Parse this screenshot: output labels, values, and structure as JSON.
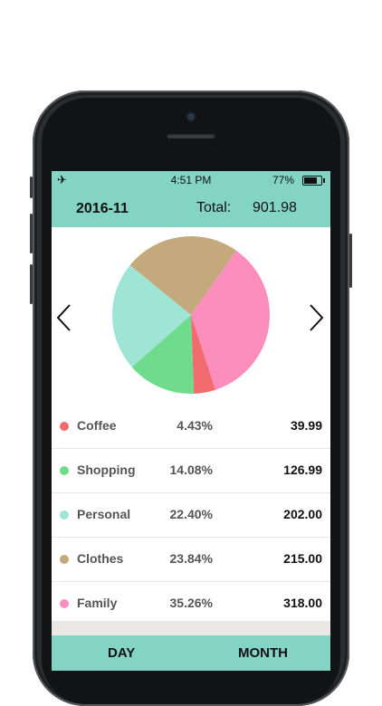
{
  "status_bar": {
    "time": "4:51 PM",
    "battery": "77%",
    "airplane_icon": "airplane-icon"
  },
  "header": {
    "month": "2016-11",
    "total_label": "Total:",
    "total_value": "901.98"
  },
  "nav": {
    "prev_icon": "chevron-left-icon",
    "next_icon": "chevron-right-icon"
  },
  "colors": {
    "accent": "#84d4c5",
    "Coffee": "#f16b6f",
    "Shopping": "#6edc8c",
    "Personal": "#9ee5d6",
    "Clothes": "#c4a97c",
    "Family": "#fb8ebd"
  },
  "categories": [
    {
      "name": "Coffee",
      "percent": "4.43%",
      "amount": "39.99",
      "share": 0.0443,
      "color": "#f16b6f"
    },
    {
      "name": "Shopping",
      "percent": "14.08%",
      "amount": "126.99",
      "share": 0.1408,
      "color": "#6edc8c"
    },
    {
      "name": "Personal",
      "percent": "22.40%",
      "amount": "202.00",
      "share": 0.224,
      "color": "#9ee5d6"
    },
    {
      "name": "Clothes",
      "percent": "23.84%",
      "amount": "215.00",
      "share": 0.2384,
      "color": "#c4a97c"
    },
    {
      "name": "Family",
      "percent": "35.26%",
      "amount": "318.00",
      "share": 0.3526,
      "color": "#fb8ebd"
    }
  ],
  "tabs": {
    "day": "DAY",
    "month": "MONTH"
  }
}
